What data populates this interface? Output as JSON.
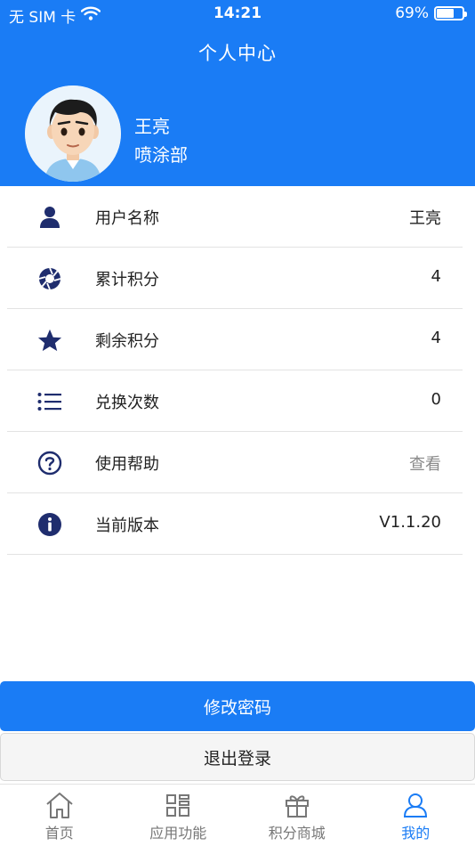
{
  "status_bar": {
    "carrier": "无 SIM 卡",
    "time": "14:21",
    "battery_text": "69%",
    "battery_level": 0.69
  },
  "header": {
    "title": "个人中心",
    "user_name": "王亮",
    "department": "喷涂部"
  },
  "items": [
    {
      "label": "用户名称",
      "value": "王亮",
      "icon": "person-icon"
    },
    {
      "label": "累计积分",
      "value": "4",
      "icon": "aperture-icon"
    },
    {
      "label": "剩余积分",
      "value": "4",
      "icon": "star-icon"
    },
    {
      "label": "兑换次数",
      "value": "0",
      "icon": "list-icon"
    },
    {
      "label": "使用帮助",
      "value": "查看",
      "icon": "help-icon"
    },
    {
      "label": "当前版本",
      "value": "V1.1.20",
      "icon": "info-icon"
    }
  ],
  "buttons": {
    "change_password": "修改密码",
    "logout": "退出登录"
  },
  "tabs": [
    {
      "label": "首页",
      "icon": "home-icon"
    },
    {
      "label": "应用功能",
      "icon": "apps-icon"
    },
    {
      "label": "积分商城",
      "icon": "gift-icon"
    },
    {
      "label": "我的",
      "icon": "user-icon",
      "active": true
    }
  ],
  "colors": {
    "brand": "#1a7cf5",
    "icon_navy": "#1f2d6e",
    "muted": "#8a8a8a"
  }
}
